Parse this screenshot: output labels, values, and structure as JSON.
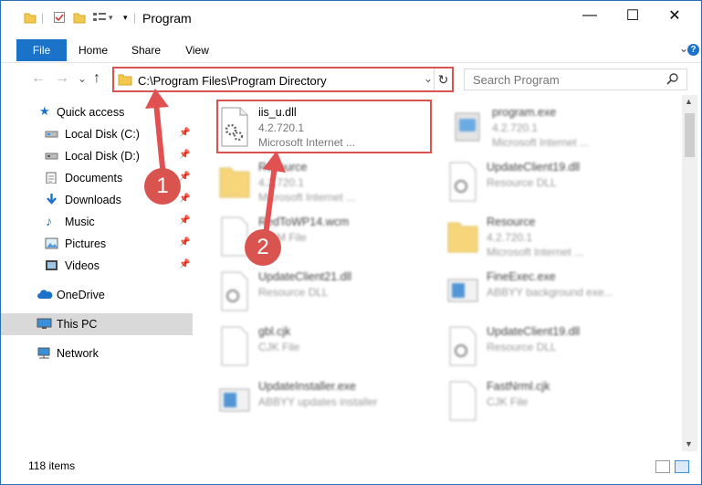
{
  "window": {
    "title": "Program",
    "controls": {
      "minimize": "—",
      "maximize": "☐",
      "close": "✕"
    }
  },
  "ribbon": {
    "tabs": [
      "File",
      "Home",
      "Share",
      "View"
    ],
    "collapse_glyph": "⌄",
    "help_glyph": "?"
  },
  "nav_buttons": {
    "back": "←",
    "forward": "→",
    "recent": "⌄",
    "up": "↑"
  },
  "address": {
    "path": "C:\\Program Files\\Program Directory",
    "dropdown": "⌄",
    "refresh": "↻"
  },
  "search": {
    "placeholder": "Search Program",
    "icon": "search-icon"
  },
  "sidebar": {
    "items": [
      {
        "label": "Quick access",
        "icon": "star-icon",
        "pinned": false
      },
      {
        "label": "Local Disk (C:)",
        "icon": "drive-icon",
        "pinned": true
      },
      {
        "label": "Local Disk (D:)",
        "icon": "drive-icon",
        "pinned": true
      },
      {
        "label": "Documents",
        "icon": "documents-icon",
        "pinned": true
      },
      {
        "label": "Downloads",
        "icon": "downloads-icon",
        "pinned": true
      },
      {
        "label": "Music",
        "icon": "music-icon",
        "pinned": true
      },
      {
        "label": "Pictures",
        "icon": "pictures-icon",
        "pinned": true
      },
      {
        "label": "Videos",
        "icon": "videos-icon",
        "pinned": true
      },
      {
        "label": "OneDrive",
        "icon": "cloud-icon",
        "pinned": false
      },
      {
        "label": "This PC",
        "icon": "computer-icon",
        "pinned": false,
        "selected": true
      },
      {
        "label": "Network",
        "icon": "network-icon",
        "pinned": false
      }
    ],
    "pin_glyph": "📌"
  },
  "files": [
    {
      "name": "iis_u.dll",
      "line2": "4.2.720.1",
      "line3": "Microsoft Internet ...",
      "type": "dll",
      "highlighted": true
    },
    {
      "name": "program.exe",
      "line2": "4.2.720.1",
      "line3": "Microsoft Internet ...",
      "type": "exe"
    },
    {
      "name": "Resource",
      "line2": "4.2.720.1",
      "line3": "Microsoft Internet ...",
      "type": "folder"
    },
    {
      "name": "UpdateClient19.dll",
      "line2": "Resource DLL",
      "line3": "",
      "type": "dll"
    },
    {
      "name": "RedToWP14.wcm",
      "line2": "WCM File",
      "line3": "",
      "type": "file"
    },
    {
      "name": "Resource",
      "line2": "4.2.720.1",
      "line3": "Microsoft Internet ...",
      "type": "folder"
    },
    {
      "name": "UpdateClient21.dll",
      "line2": "Resource DLL",
      "line3": "",
      "type": "dll"
    },
    {
      "name": "FineExec.exe",
      "line2": "ABBYY background exe...",
      "line3": "",
      "type": "exe2"
    },
    {
      "name": "gbl.cjk",
      "line2": "CJK File",
      "line3": "",
      "type": "file"
    },
    {
      "name": "UpdateClient19.dll",
      "line2": "Resource DLL",
      "line3": "",
      "type": "dll"
    },
    {
      "name": "UpdateInstaller.exe",
      "line2": "ABBYY updates installer",
      "line3": "",
      "type": "exe2"
    },
    {
      "name": "FastNrml.cjk",
      "line2": "CJK File",
      "line3": "",
      "type": "file"
    }
  ],
  "status": {
    "item_count": "118 items"
  },
  "annotations": [
    {
      "label": "1",
      "color": "#d9534f"
    },
    {
      "label": "2",
      "color": "#d9534f"
    }
  ],
  "colors": {
    "accent": "#1a73c9",
    "annotation": "#d9534f",
    "selection": "#d9d9d9"
  }
}
